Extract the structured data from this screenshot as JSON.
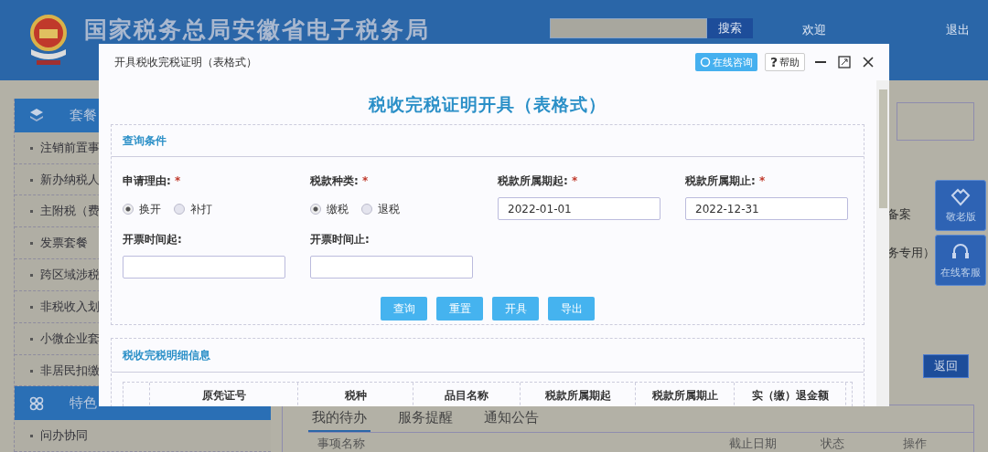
{
  "header": {
    "site_title": "国家税务总局安徽省电子税务局",
    "search_button": "搜索",
    "welcome": "欢迎",
    "logout": "退出"
  },
  "sidebar": {
    "groups": [
      {
        "title": "套餐",
        "expanded": true,
        "items": [
          "注销前置事",
          "新办纳税人",
          "主附税（费",
          "发票套餐",
          "跨区域涉税",
          "非税收入划",
          "小微企业套",
          "非居民扣缴"
        ]
      },
      {
        "title": "特色",
        "expanded": true,
        "items": [
          "问办协同"
        ]
      }
    ]
  },
  "main": {
    "notes": [
      "备案",
      "务专用）"
    ],
    "back_button": "返回",
    "tabs": [
      {
        "label": "我的待办",
        "selected": true
      },
      {
        "label": "服务提醒",
        "selected": false
      },
      {
        "label": "通知公告",
        "selected": false
      }
    ],
    "list_columns": [
      "事项名称",
      "截止日期",
      "状态",
      "操作"
    ]
  },
  "float_buttons": [
    {
      "label": "敬老版"
    },
    {
      "label": "在线客服"
    }
  ],
  "dialog": {
    "title": "开具税收完税证明（表格式）",
    "consult_button": "在线咨询",
    "help_button": {
      "mark": "?",
      "label": "帮助"
    },
    "heading": "税收完税证明开具（表格式）",
    "query_section": {
      "title": "查询条件",
      "fields": [
        {
          "kind": "radio",
          "label": "申请理由:",
          "required_mark": "*",
          "options": [
            {
              "label": "换开",
              "selected": true
            },
            {
              "label": "补打",
              "selected": false
            }
          ]
        },
        {
          "kind": "radio",
          "label": "税款种类:",
          "required_mark": "*",
          "options": [
            {
              "label": "缴税",
              "selected": true
            },
            {
              "label": "退税",
              "selected": false
            }
          ]
        },
        {
          "kind": "input",
          "label": "税款所属期起:",
          "required_mark": "*",
          "value": "2022-01-01"
        },
        {
          "kind": "input",
          "label": "税款所属期止:",
          "required_mark": "*",
          "value": "2022-12-31"
        },
        {
          "kind": "input",
          "label": "开票时间起:"
        },
        {
          "kind": "input",
          "label": "开票时间止:"
        }
      ],
      "buttons": [
        "查询",
        "重置",
        "开具",
        "导出"
      ]
    },
    "detail_section": {
      "title": "税收完税明细信息",
      "columns": [
        "",
        "原凭证号",
        "税种",
        "品目名称",
        "税款所属期起",
        "税款所属期止",
        "实（缴）退金额"
      ]
    }
  }
}
